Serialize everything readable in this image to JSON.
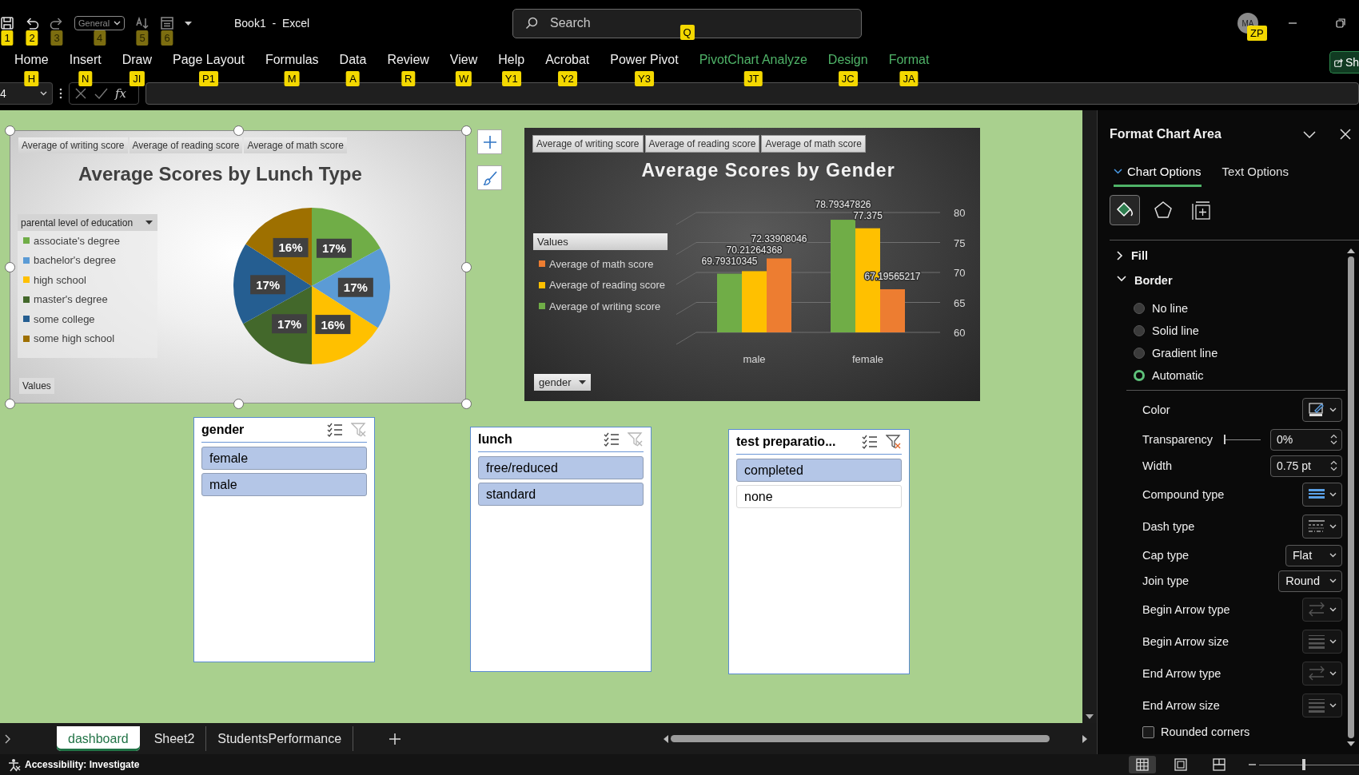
{
  "title_bar": {
    "quick_access": [
      {
        "kind": "save",
        "keytip": "1",
        "disabled": false
      },
      {
        "kind": "undo",
        "keytip": "2",
        "disabled": false
      },
      {
        "kind": "redo",
        "keytip": "3",
        "disabled": true
      },
      {
        "kind": "format",
        "keytip": "4",
        "disabled": true,
        "value": "General"
      },
      {
        "kind": "sort",
        "keytip": "5",
        "disabled": true
      },
      {
        "kind": "form",
        "keytip": "6",
        "disabled": true
      }
    ],
    "document_title": "Book1  -  Excel",
    "search": {
      "placeholder": "Search",
      "keytip": "Q"
    },
    "account": {
      "initials": "MA",
      "keytip": "ZP"
    }
  },
  "ribbon_tabs": [
    {
      "label": "Home",
      "keytip": "H",
      "contextual": false
    },
    {
      "label": "Insert",
      "keytip": "N",
      "contextual": false
    },
    {
      "label": "Draw",
      "keytip": "JI",
      "contextual": false
    },
    {
      "label": "Page Layout",
      "keytip": "P1",
      "contextual": false
    },
    {
      "label": "Formulas",
      "keytip": "M",
      "contextual": false
    },
    {
      "label": "Data",
      "keytip": "A",
      "contextual": false
    },
    {
      "label": "Review",
      "keytip": "R",
      "contextual": false
    },
    {
      "label": "View",
      "keytip": "W",
      "contextual": false
    },
    {
      "label": "Help",
      "keytip": "Y1",
      "contextual": false
    },
    {
      "label": "Acrobat",
      "keytip": "Y2",
      "contextual": false
    },
    {
      "label": "Power Pivot",
      "keytip": "Y3",
      "contextual": false
    },
    {
      "label": "PivotChart Analyze",
      "keytip": "JT",
      "contextual": true
    },
    {
      "label": "Design",
      "keytip": "JC",
      "contextual": true
    },
    {
      "label": "Format",
      "keytip": "JA",
      "contextual": true
    }
  ],
  "share_button": {
    "label": "Sh"
  },
  "formula_bar": {
    "name_box": "4",
    "function_button": "fx"
  },
  "charts": [
    {
      "selected": true,
      "field_buttons": [
        "Average of writing score",
        "Average of reading score",
        "Average of math score"
      ],
      "legend_button": "parental level of education",
      "legend": [
        {
          "color": "#70ad47"
        },
        {
          "color": "#5b9bd5"
        },
        {
          "color": "#ffc000"
        },
        {
          "color": "#43682b"
        },
        {
          "color": "#255e91"
        },
        {
          "color": "#9e7000"
        }
      ],
      "values_button": "Values",
      "chart_data": {
        "type": "pie",
        "title": "Average Scores by Lunch Type",
        "categories": [
          "associate's degree",
          "bachelor's degree",
          "high school",
          "master's degree",
          "some college",
          "some high school"
        ],
        "values": [
          17,
          17,
          16,
          17,
          17,
          16
        ],
        "data_labels": true,
        "value_labels": [
          "17%",
          "17%",
          "16%",
          "17%",
          "17%",
          "16%"
        ]
      }
    },
    {
      "selected": false,
      "field_buttons": [
        "Average of writing score",
        "Average of reading score",
        "Average of math score"
      ],
      "legend_button": "Values",
      "axis_button": "gender",
      "chart_data": {
        "type": "bar",
        "title": "Average Scores by Gender",
        "categories": [
          "male",
          "female"
        ],
        "series": [
          {
            "name": "Average of writing score",
            "color": "#70ad47",
            "values": [
              69.79310345,
              78.79347826
            ]
          },
          {
            "name": "Average of reading score",
            "color": "#ffc000",
            "values": [
              70.21264368,
              77.375
            ]
          },
          {
            "name": "Average of math score",
            "color": "#ed7d31",
            "values": [
              72.33908046,
              67.19565217
            ]
          }
        ],
        "ylim": [
          60,
          80
        ],
        "yticks": [
          60,
          65,
          70,
          75,
          80
        ],
        "grid": true,
        "stacked": false,
        "data_labels": true
      }
    }
  ],
  "slicers": [
    {
      "title": "gender",
      "filtered": false,
      "items": [
        {
          "label": "female",
          "selected": true
        },
        {
          "label": "male",
          "selected": true
        }
      ]
    },
    {
      "title": "lunch",
      "filtered": false,
      "items": [
        {
          "label": "free/reduced",
          "selected": true
        },
        {
          "label": "standard",
          "selected": true
        }
      ]
    },
    {
      "title": "test preparatio...",
      "filtered": true,
      "items": [
        {
          "label": "completed",
          "selected": true
        },
        {
          "label": "none",
          "selected": false
        }
      ]
    }
  ],
  "format_pane": {
    "title": "Format Chart Area",
    "tabs": [
      {
        "label": "Chart Options",
        "selected": true
      },
      {
        "label": "Text Options",
        "selected": false
      }
    ],
    "icon_tabs": [
      {
        "kind": "fill",
        "selected": true
      },
      {
        "kind": "effects",
        "selected": false
      },
      {
        "kind": "size",
        "selected": false
      }
    ],
    "sections": [
      {
        "label": "Fill",
        "expanded": false
      },
      {
        "label": "Border",
        "expanded": true,
        "options": [
          {
            "label": "No line",
            "selected": false
          },
          {
            "label": "Solid line",
            "selected": false
          },
          {
            "label": "Gradient line",
            "selected": false
          },
          {
            "label": "Automatic",
            "selected": true
          }
        ],
        "properties": [
          {
            "label": "Color",
            "kind": "color",
            "disabled": false
          },
          {
            "label": "Transparency",
            "kind": "slider",
            "value": "0%",
            "level": 0,
            "disabled": false
          },
          {
            "label": "Width",
            "kind": "spin",
            "value": "0.75 pt",
            "disabled": false
          },
          {
            "label": "Compound type",
            "kind": "compound",
            "disabled": false
          },
          {
            "label": "Dash type",
            "kind": "dash",
            "disabled": false
          },
          {
            "label": "Cap type",
            "kind": "dropdown",
            "value": "Flat",
            "disabled": false
          },
          {
            "label": "Join type",
            "kind": "dropdown",
            "value": "Round",
            "disabled": false
          },
          {
            "label": "Begin Arrow type",
            "kind": "arrows",
            "disabled": true
          },
          {
            "label": "Begin Arrow size",
            "kind": "sizes",
            "disabled": true
          },
          {
            "label": "End Arrow type",
            "kind": "arrows",
            "disabled": true
          },
          {
            "label": "End Arrow size",
            "kind": "sizes",
            "disabled": true
          }
        ],
        "rounded_corners": {
          "label": "Rounded corners",
          "checked": false
        }
      }
    ]
  },
  "sheet_tabs": [
    {
      "label": "dashboard",
      "selected": true
    },
    {
      "label": "Sheet2",
      "selected": false
    },
    {
      "label": "StudentsPerformance",
      "selected": false
    }
  ],
  "status_bar": {
    "accessibility": "Accessibility: Investigate",
    "views": [
      {
        "kind": "normal",
        "selected": true
      },
      {
        "kind": "page_layout",
        "selected": false
      },
      {
        "kind": "page_break",
        "selected": false
      }
    ],
    "zoom": {
      "level": 0.45
    }
  }
}
